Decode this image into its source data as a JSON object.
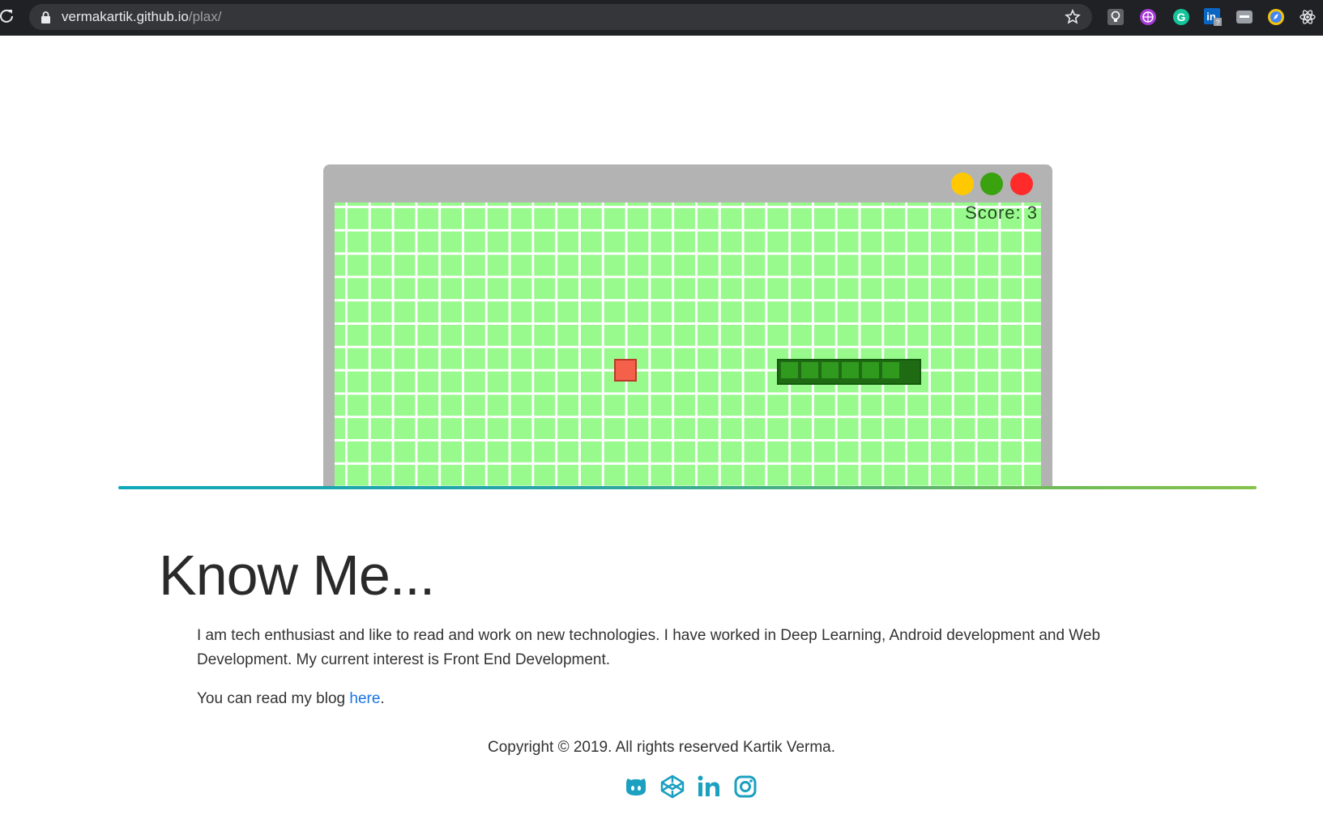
{
  "browser": {
    "url_host": "vermakartik.github.io",
    "url_path": "/plax/",
    "icons": [
      "reload-icon",
      "lock-icon",
      "bookmark-star-icon",
      "extension-lightbulb-icon",
      "extension-globe-icon",
      "grammarly-icon",
      "linkedin-extension-icon",
      "extension-chat-icon",
      "extension-compass-icon",
      "react-devtools-icon"
    ],
    "linkedin_badge": "?"
  },
  "game": {
    "score_label": "Score: 3",
    "window_buttons": [
      "minimize",
      "maximize",
      "close"
    ],
    "colors": {
      "board": "#98f98c",
      "food": "#f4604a",
      "snake": "#1f6b14",
      "minimize": "#ffc800",
      "maximize": "#3aa10f",
      "close": "#ff2a2a"
    }
  },
  "about": {
    "heading": "Know Me...",
    "paragraph": "I am tech enthusiast and like to read and work on new technologies. I have worked in Deep Learning, Android development and Web Development. My current interest is Front End Development.",
    "blog_prefix": "You can read my blog ",
    "blog_link_text": "here",
    "blog_suffix": "."
  },
  "footer": {
    "copyright": "Copyright © 2019. All rights reserved Kartik Verma.",
    "social": [
      "github-icon",
      "codepen-icon",
      "linkedin-icon",
      "instagram-icon"
    ],
    "accent": "#1ba0c0"
  }
}
